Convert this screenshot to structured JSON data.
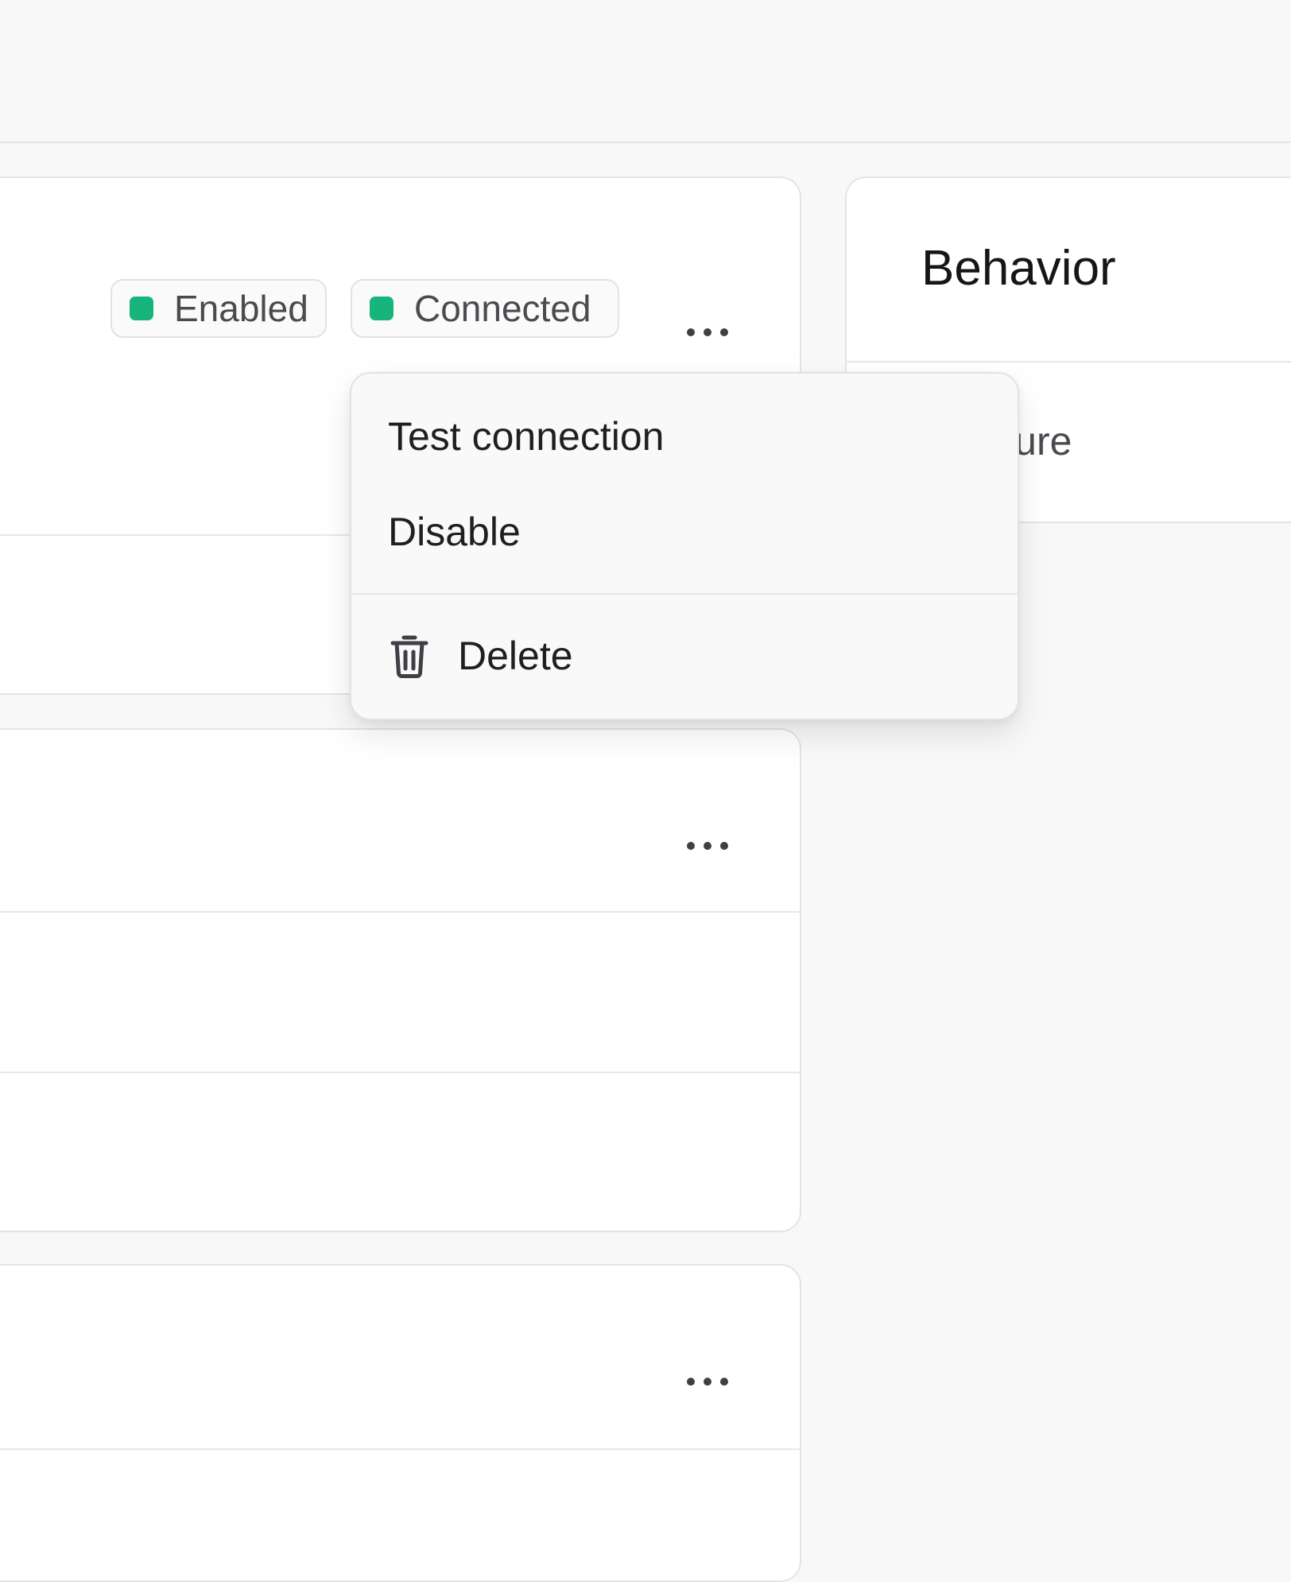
{
  "connection_card": {
    "badges": [
      {
        "label": "Enabled",
        "color": "#17b57c"
      },
      {
        "label": "Connected",
        "color": "#17b57c"
      }
    ],
    "more_icon": "more-horizontal-icon"
  },
  "context_menu": {
    "items": [
      {
        "label": "Test connection"
      },
      {
        "label": "Disable"
      },
      {
        "label": "Delete",
        "icon": "trash-icon"
      }
    ]
  },
  "behavior_card": {
    "title": "Behavior",
    "value_partial": "-capture"
  },
  "colors": {
    "page_bg": "#f8f8f8",
    "card_bg": "#ffffff",
    "border": "#e4e4e4",
    "status_green": "#17b57c",
    "menu_bg": "#f9f9f9"
  }
}
